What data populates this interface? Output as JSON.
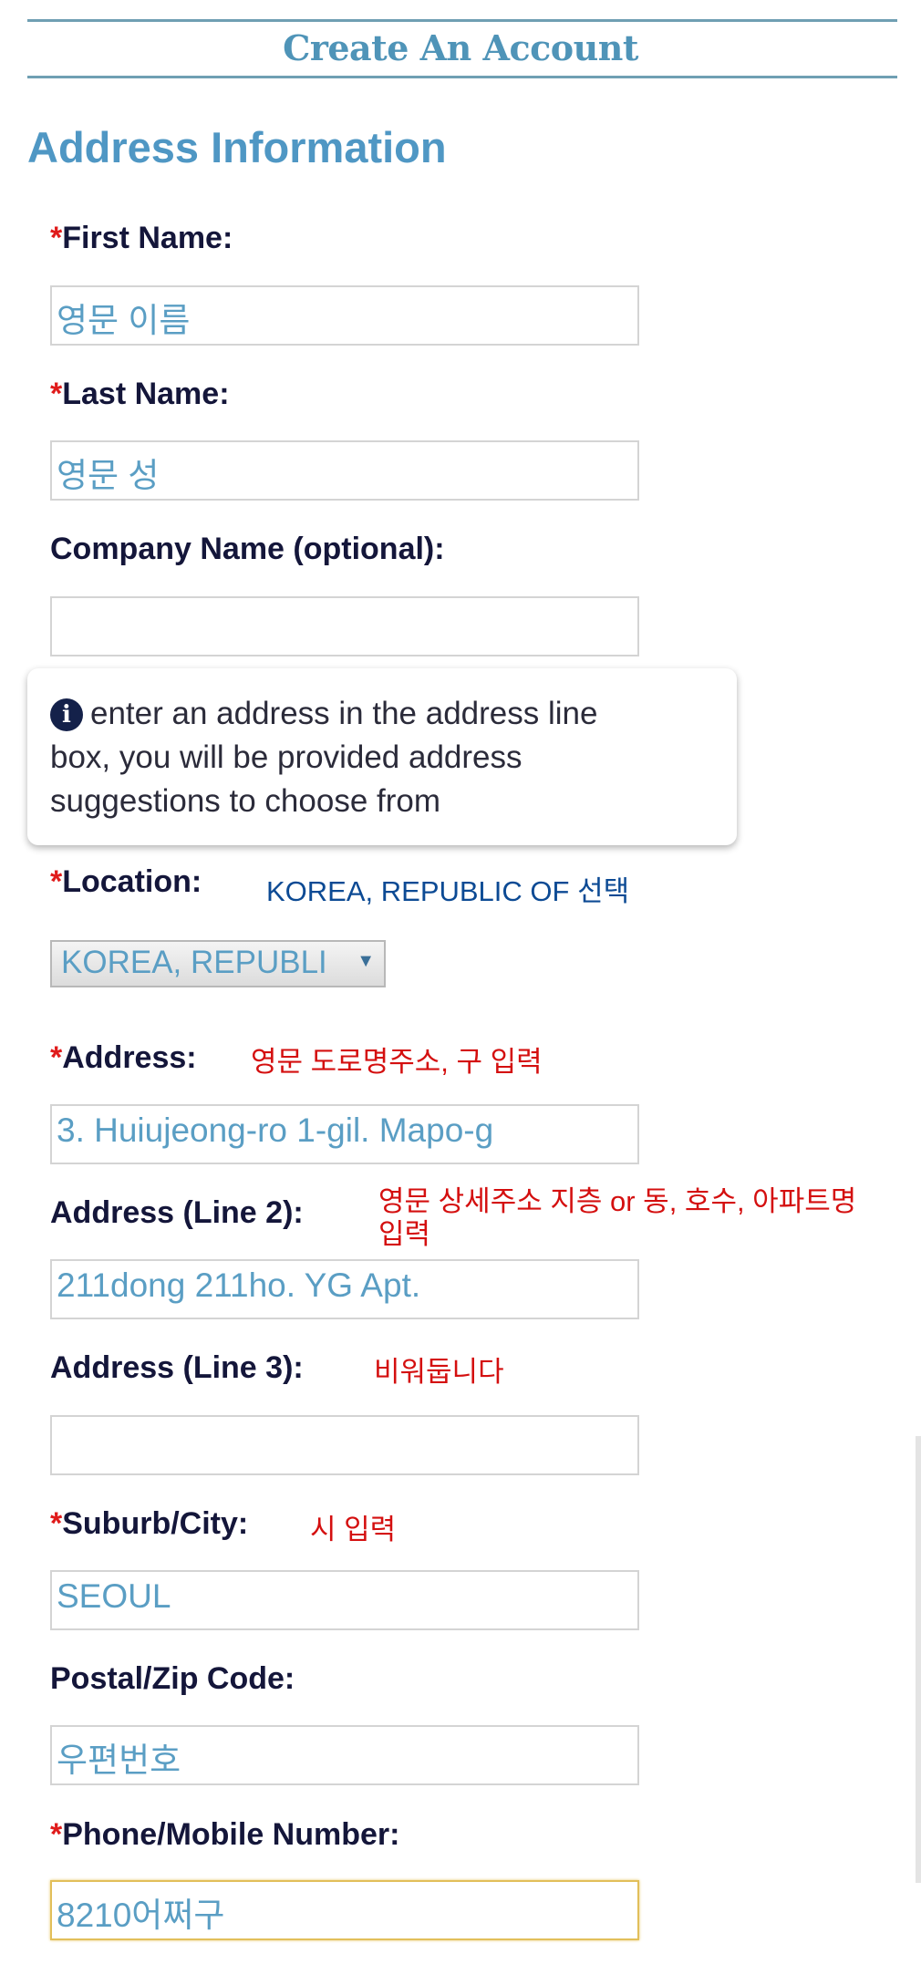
{
  "header": {
    "title": "Create An Account"
  },
  "section": {
    "title": "Address Information"
  },
  "fields": {
    "first_name": {
      "required": "*",
      "label": "First Name:",
      "value": "영문 이름"
    },
    "last_name": {
      "required": "*",
      "label": "Last Name:",
      "value": "영문 성"
    },
    "company": {
      "label": "Company Name (optional):",
      "value": ""
    },
    "location": {
      "required": "*",
      "label": "Location:",
      "value": "KOREA, REPUBLI",
      "note": "KOREA, REPUBLIC OF 선택"
    },
    "address": {
      "required": "*",
      "label": "Address:",
      "value": "3. Huiujeong-ro 1-gil. Mapo-g",
      "note": "영문 도로명주소, 구 입력"
    },
    "address2": {
      "label": "Address (Line 2):",
      "value": "211dong 211ho. YG Apt.",
      "note_line1": "영문 상세주소 지층 or 동, 호수, 아파트명",
      "note_line2": "입력"
    },
    "address3": {
      "label": "Address (Line 3):",
      "value": "",
      "note": "비워둡니다"
    },
    "city": {
      "required": "*",
      "label": "Suburb/City:",
      "value": "SEOUL",
      "note": "시 입력"
    },
    "postal": {
      "label": "Postal/Zip Code:",
      "value": "우편번호"
    },
    "phone": {
      "required": "*",
      "label": "Phone/Mobile Number:",
      "value": "8210어쩌구"
    }
  },
  "info": {
    "icon": "info-circle-icon",
    "text_line1": "enter an address in the address line",
    "text_line2": "box, you will be provided address",
    "text_line3": "suggestions to choose from"
  },
  "colors": {
    "accent": "#4f97c4",
    "label": "#14163a",
    "required": "#e01b1b",
    "note_red": "#d40f0f",
    "note_blue": "#0c4a94",
    "focus_border": "#e2bf5a"
  }
}
